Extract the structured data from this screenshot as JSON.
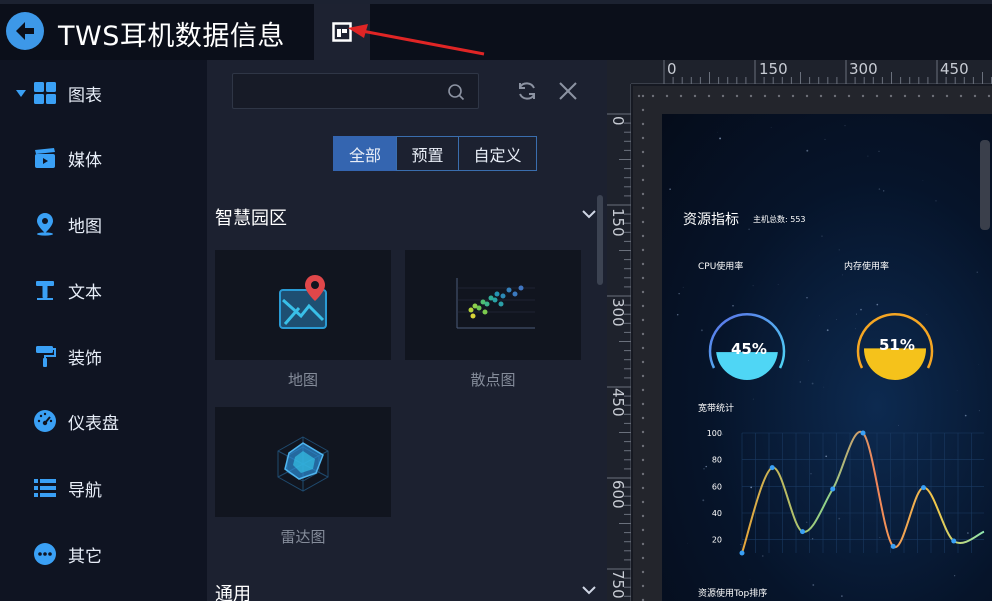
{
  "header": {
    "title": "TWS耳机数据信息"
  },
  "sidebar": {
    "items": [
      {
        "label": "图表",
        "icon": "grid-icon",
        "expanded": true
      },
      {
        "label": "媒体",
        "icon": "clapper-icon"
      },
      {
        "label": "地图",
        "icon": "map-pin-icon"
      },
      {
        "label": "文本",
        "icon": "text-icon"
      },
      {
        "label": "装饰",
        "icon": "paint-roller-icon"
      },
      {
        "label": "仪表盘",
        "icon": "gauge-icon"
      },
      {
        "label": "导航",
        "icon": "list-icon"
      },
      {
        "label": "其它",
        "icon": "more-icon"
      }
    ]
  },
  "panel": {
    "search": {
      "value": "",
      "placeholder": ""
    },
    "tabs": [
      {
        "label": "全部",
        "active": true
      },
      {
        "label": "预置",
        "active": false
      },
      {
        "label": "自定义",
        "active": false
      }
    ],
    "sections": [
      {
        "title": "智慧园区",
        "cards": [
          {
            "label": "地图",
            "icon": "map-chart-icon"
          },
          {
            "label": "散点图",
            "icon": "scatter-chart-icon"
          },
          {
            "label": "雷达图",
            "icon": "radar-chart-icon"
          }
        ]
      },
      {
        "title": "通用",
        "cards": []
      }
    ]
  },
  "canvas": {
    "ruler_top": [
      "0",
      "150",
      "300",
      "450"
    ],
    "ruler_left": [
      "0",
      "150",
      "300",
      "450",
      "600",
      "750"
    ],
    "screen": {
      "title": "资源指标",
      "host_total_label": "主机总数: 553",
      "cpu": {
        "label": "CPU使用率",
        "value_text": "45%",
        "value": 45
      },
      "memory": {
        "label": "内存使用率",
        "value_text": "51%",
        "value": 51
      },
      "bandwidth_title": "宽带统计",
      "top_title": "资源使用Top排序"
    }
  },
  "colors": {
    "accent": "#3d98e8",
    "tab_active": "#3465b0",
    "cpu_fill": "#4fd6f5",
    "memory_fill": "#f5c21b"
  },
  "chart_data": {
    "type": "line",
    "title": "宽带统计",
    "ylabel": "",
    "yticks": [
      20,
      40,
      60,
      80,
      100
    ],
    "ylim": [
      20,
      100
    ],
    "series": [
      {
        "values": [
          10,
          74,
          26,
          58,
          100,
          15,
          59,
          19,
          26
        ]
      }
    ]
  }
}
